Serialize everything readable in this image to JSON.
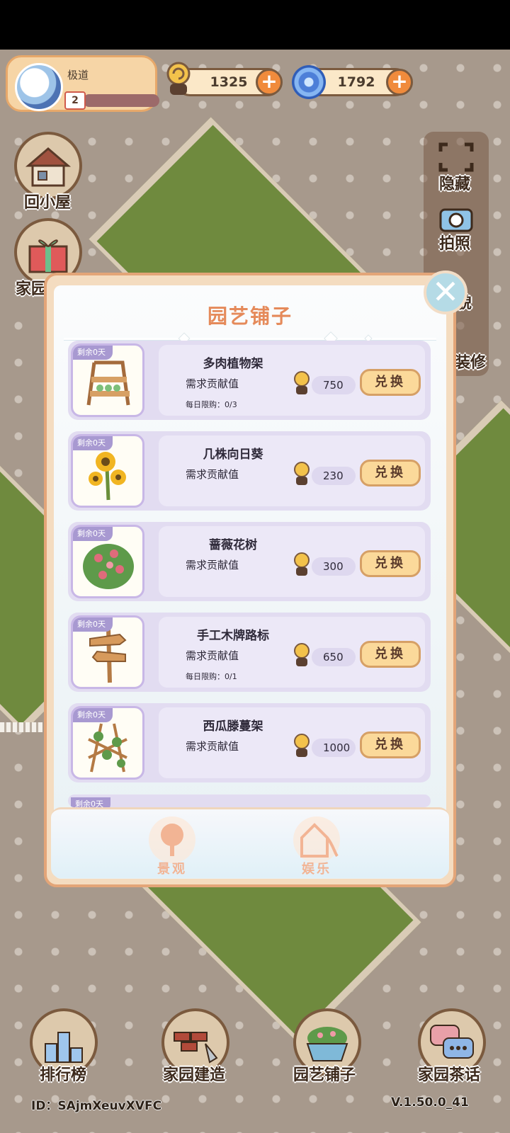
{
  "player": {
    "name": "极道",
    "level": "2"
  },
  "currencies": {
    "snail": "1325",
    "gem": "1792"
  },
  "left_buttons": {
    "home": "回小屋",
    "gift": "家园"
  },
  "right_panel": {
    "hide": "隐藏",
    "photo": "拍照",
    "look": "貌",
    "decor": "装修"
  },
  "modal": {
    "title": "园艺铺子",
    "requirement_label": "需求贡献值",
    "exchange_label": "兑换",
    "days_label": "剩余0天",
    "items": [
      {
        "name": "多肉植物架",
        "cost": "750",
        "limit": "每日限购：0/3",
        "icon": "succulent-shelf-icon"
      },
      {
        "name": "几株向日葵",
        "cost": "230",
        "limit": "",
        "icon": "sunflower-icon"
      },
      {
        "name": "蔷薇花树",
        "cost": "300",
        "limit": "",
        "icon": "rose-bush-icon"
      },
      {
        "name": "手工木牌路标",
        "cost": "650",
        "limit": "每日限购：0/1",
        "icon": "wooden-signpost-icon"
      },
      {
        "name": "西瓜滕蔓架",
        "cost": "1000",
        "limit": "",
        "icon": "watermelon-trellis-icon"
      }
    ],
    "partial_days_label": "剩余0天",
    "tabs": {
      "landscape": "景观",
      "entertainment": "娱乐"
    }
  },
  "bottom_nav": {
    "ranking": "排行榜",
    "build": "家园建造",
    "shop": "园艺铺子",
    "chat": "家园茶话"
  },
  "footer": {
    "id": "ID：SAjmXeuvXVFC",
    "version": "V.1.50.0_41"
  }
}
